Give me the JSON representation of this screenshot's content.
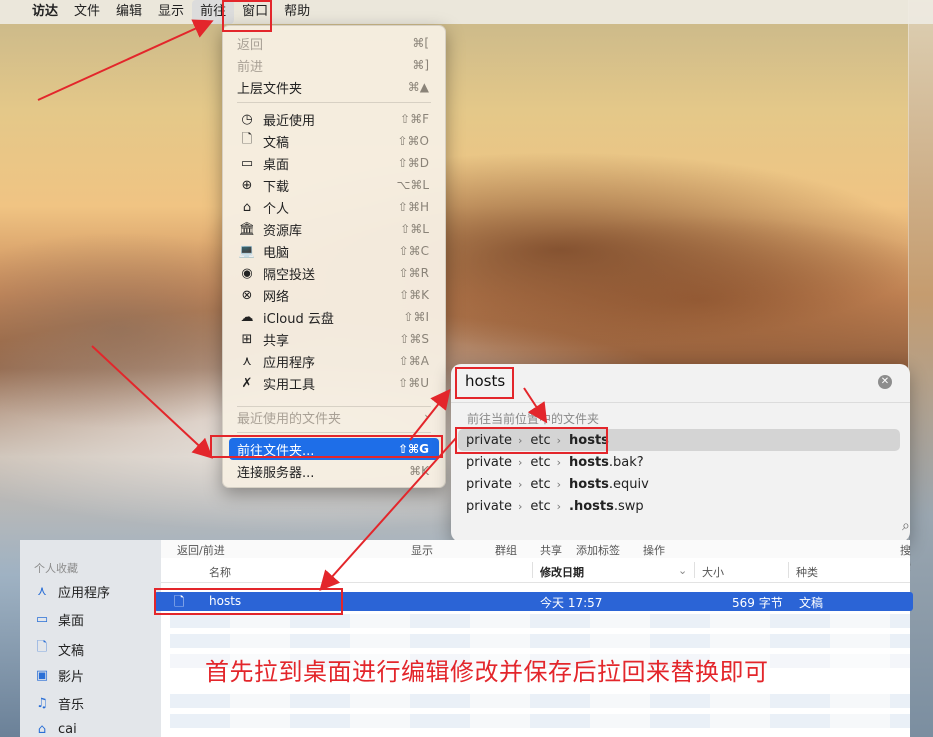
{
  "menubar": {
    "apple": "",
    "items": [
      "访达",
      "文件",
      "编辑",
      "显示",
      "前往",
      "窗口",
      "帮助"
    ]
  },
  "go_menu": {
    "back": {
      "label": "返回",
      "shortcut": "⌘["
    },
    "forward": {
      "label": "前进",
      "shortcut": "⌘]"
    },
    "enclosing": {
      "label": "上层文件夹",
      "shortcut": "⌘▲"
    },
    "places": [
      {
        "icon": "clock-icon",
        "glyph": "◷",
        "label": "最近使用",
        "shortcut": "⇧⌘F"
      },
      {
        "icon": "document-icon",
        "glyph": "🗋",
        "label": "文稿",
        "shortcut": "⇧⌘O"
      },
      {
        "icon": "desktop-icon",
        "glyph": "▭",
        "label": "桌面",
        "shortcut": "⇧⌘D"
      },
      {
        "icon": "download-icon",
        "glyph": "⊕",
        "label": "下载",
        "shortcut": "⌥⌘L"
      },
      {
        "icon": "home-icon",
        "glyph": "⌂",
        "label": "个人",
        "shortcut": "⇧⌘H"
      },
      {
        "icon": "library-icon",
        "glyph": "🏛",
        "label": "资源库",
        "shortcut": "⇧⌘L"
      },
      {
        "icon": "computer-icon",
        "glyph": "💻",
        "label": "电脑",
        "shortcut": "⇧⌘C"
      },
      {
        "icon": "airdrop-icon",
        "glyph": "◉",
        "label": "隔空投送",
        "shortcut": "⇧⌘R"
      },
      {
        "icon": "network-icon",
        "glyph": "⊗",
        "label": "网络",
        "shortcut": "⇧⌘K"
      },
      {
        "icon": "icloud-icon",
        "glyph": "☁",
        "label": "iCloud 云盘",
        "shortcut": "⇧⌘I"
      },
      {
        "icon": "shared-folder-icon",
        "glyph": "⊞",
        "label": "共享",
        "shortcut": "⇧⌘S"
      },
      {
        "icon": "applications-icon",
        "glyph": "⋏",
        "label": "应用程序",
        "shortcut": "⇧⌘A"
      },
      {
        "icon": "utilities-icon",
        "glyph": "✗",
        "label": "实用工具",
        "shortcut": "⇧⌘U"
      }
    ],
    "recent_folders": {
      "label": "最近使用的文件夹",
      "arrow": "›"
    },
    "go_to_folder": {
      "label": "前往文件夹...",
      "shortcut": "⇧⌘G"
    },
    "connect_server": {
      "label": "连接服务器...",
      "shortcut": "⌘K"
    }
  },
  "goto_panel": {
    "input_value": "hosts",
    "hint": "前往当前位置中的文件夹",
    "clear": "✕",
    "results": [
      {
        "path": [
          "private",
          "etc"
        ],
        "bold": "hosts",
        "suffix": ""
      },
      {
        "path": [
          "private",
          "etc"
        ],
        "bold": "hosts",
        "suffix": ".bak?"
      },
      {
        "path": [
          "private",
          "etc"
        ],
        "bold": "hosts",
        "suffix": ".equiv"
      },
      {
        "path": [
          "private",
          "etc"
        ],
        "bold": ".hosts",
        "suffix": ".swp"
      }
    ]
  },
  "finder": {
    "toolbar": {
      "back_forward": "返回/前进",
      "view": "显示",
      "group": "群组",
      "share": "共享",
      "tags": "添加标签",
      "action": "操作",
      "search": "搜索"
    },
    "sidebar": {
      "heading": "个人收藏",
      "items": [
        {
          "icon": "applications-icon",
          "glyph": "⋏",
          "label": "应用程序"
        },
        {
          "icon": "desktop-icon",
          "glyph": "▭",
          "label": "桌面"
        },
        {
          "icon": "document-icon",
          "glyph": "🗋",
          "label": "文稿"
        },
        {
          "icon": "movies-icon",
          "glyph": "▣",
          "label": "影片"
        },
        {
          "icon": "music-icon",
          "glyph": "♫",
          "label": "音乐"
        },
        {
          "icon": "home-icon",
          "glyph": "⌂",
          "label": "cai"
        }
      ]
    },
    "columns": {
      "name": "名称",
      "modified": "修改日期",
      "size": "大小",
      "kind": "种类"
    },
    "selected_file": {
      "name": "hosts",
      "modified": "今天 17:57",
      "size": "569 字节",
      "kind": "文稿"
    }
  },
  "annotation": {
    "caption": "首先拉到桌面进行编辑修改并保存后拉回来替换即可",
    "color": "#e3262b"
  }
}
